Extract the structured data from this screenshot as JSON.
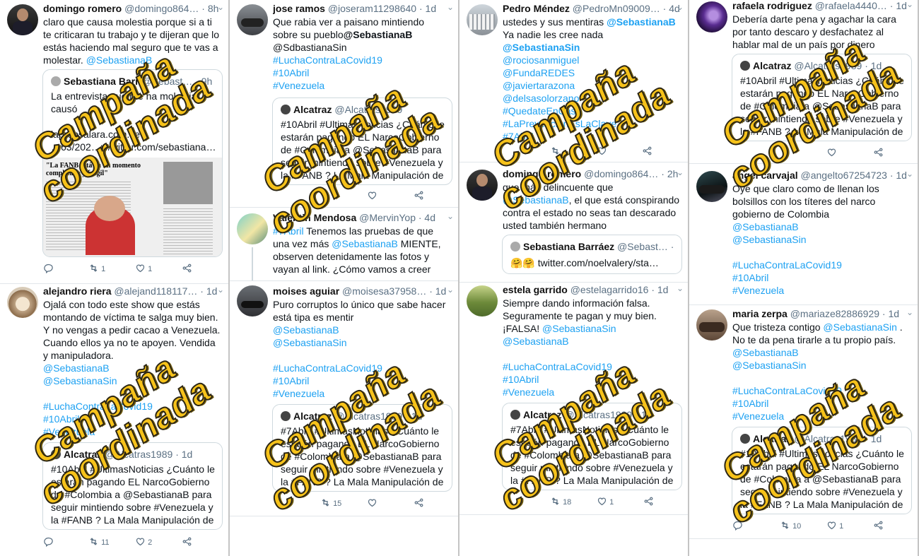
{
  "watermark": {
    "line1": "Campaña",
    "line2": "coordinada"
  },
  "col0": {
    "t1": {
      "name": "domingo romero",
      "handle": "@domingo864…",
      "time": "· 8h",
      "text_a": "claro que causa molestia porque si a ti te criticaran tu trabajo y te dijeran que lo estás haciendo mal seguro que te vas a molestar. ",
      "mention": "@SebastianaB",
      "q_name": "Sebastiana Barr",
      "q_handle": "@Sebast…",
      "q_time": "· 9h",
      "q_text": "La entrevista que me ha molestia causó",
      "q_link1": "laprensalara.com.ve",
      "q_link2": "…63/202…w/witter.com/sebastiana…",
      "img_head": "\"La FANB está en un momento complicado y frágil\"",
      "rt": "1",
      "like": "1"
    },
    "t2": {
      "name": "alejandro riera",
      "handle": "@alejand118117…",
      "time": "· 1d",
      "text": "Ojalá con todo este show que estás montando de víctima te salga muy bien. Y no vengas a pedir cacao a Venezuela. Cuando ellos ya no te apoyen. Vendida y manipuladora.",
      "m1": "@SebastianaB",
      "m2": "@SebastianaSin",
      "h1": "#LuchaContraLaCovid19",
      "h2": "#10Abril",
      "h3": "#Venezuela",
      "q_name": "Alcatraz",
      "q_handle": "@Alcatras1989",
      "q_time": "· 1d",
      "q_text": "#10Abril #UltimasNoticias ¿Cuánto le estarán pagando EL NarcoGobierno de #Colombia a  @SebastianaB para seguir mintiendo sobre #Venezuela y la #FANB ? La Mala Manipulación de …",
      "rt": "11",
      "like": "2"
    }
  },
  "col1": {
    "t1": {
      "name": "jose ramos",
      "handle": "@joseram11298640",
      "time": "· 1d",
      "text_a": "Que rabia ver a paisano mintiendo sobre su pueblo",
      "bold": "@SebastianaB",
      "line2": "@SdbastianaSin",
      "h1": "#LuchaContraLaCovid19",
      "h2": "#10Abril",
      "h3": "#Venezuela",
      "q_name": "Alcatraz",
      "q_handle": "@Alcatras1989",
      "q_text": "#10Abril #UltimasNoticias ¿Cuánto le estarán pagando EL NarcoGobierno de #Colombia a @SebastianaB para seguir mintiendo sobre #Venezuela y la #FANB ? La Mala Manipulación de …",
      "rt": "6"
    },
    "t2": {
      "name": "Valentin Mendosa",
      "handle": "@MervinYop",
      "time": "· 4d",
      "tag": "#7Abril",
      "text_a": " Tenemos las pruebas de que una vez más ",
      "mention": "@SebastianaB",
      "text_b": " MIENTE, observen detenidamente las fotos y vayan al link. ¿Cómo vamos a creer"
    },
    "t3": {
      "name": "moises aguiar",
      "handle": "@moisesa37958…",
      "time": "· 1d",
      "text": "Puro corruptos lo único que sabe hacer está tipa es mentir",
      "m1": "@SebastianaB",
      "m2": "@SebastianaSin",
      "h1": "#LuchaContraLaCovid19",
      "h2": "#10Abril",
      "h3": "#Venezuela",
      "q_name": "Alcatraz",
      "q_handle": "@Alcatras1989",
      "q_time": "· 1d",
      "q_text": "#7Abril #UltimasNoticias ¿Cuánto le estarán pagando EL NarcoGobierno de #Colombia a @SebastianaB para seguir mintiendo sobre #Venezuela y la #FANB ? La Mala Manipulación de …",
      "rt": "15"
    }
  },
  "col2": {
    "t1": {
      "name": "Pedro Méndez",
      "handle": "@PedroMn09009…",
      "time": "· 4d",
      "text_a": "ustedes y sus mentiras ",
      "mention": "@SebastianaB",
      "text_b": " Ya nadie les cree nada",
      "m_bold": "@SebastianaSin",
      "m2": "@rociosanmiguel",
      "m3": "@FundaREDES",
      "m4": "@javiertarazona",
      "m5": "@delsasolorzano",
      "h1": "#QuedateEnCasa",
      "h2": "#LaPrevencionEsLaClave",
      "h3": "#7Abril"
    },
    "t2": {
      "name": "domingo romero",
      "handle": "@domingo864…",
      "time": "· 2h",
      "text_a": "que más delincuente que ",
      "mention": "@SebastianaB",
      "text_b": ", el que está conspirando contra el estado no seas tan descarado usted también hermano",
      "q_name": "Sebastiana Barráez",
      "q_handle": "@Sebast…",
      "q_time": "· 5h",
      "q_text": "🤗🤗 twitter.com/noelvalery/sta…"
    },
    "t3": {
      "name": "estela garrido",
      "handle": "@estelagarrido16",
      "time": "· 1d",
      "text": "Siempre dando información falsa. Seguramente te pagan y muy bien. ¡FALSA! ",
      "m1": "@SebastianaSin",
      "m2": "@SebastianaB",
      "h1": "#LuchaContraLaCovid19",
      "h2": "#10Abril",
      "h3": "#Venezuela",
      "q_name": "Alcatraz",
      "q_handle": "@Alcatras1989",
      "q_time": "· 1d",
      "q_text": "#7Abril #UltimasNoticias ¿Cuánto le estarán pagando EL NarcoGobierno de #Colombia a @SebastianaB para seguir mintiendo sobre #Venezuela y la #FANB ? La Mala Manipulación de …",
      "rt": "18",
      "like": "1"
    }
  },
  "col3": {
    "t1": {
      "name": "rafaela rodriguez",
      "handle": "@rafaela4440…",
      "time": "· 1d",
      "text": "Debería darte pena y agachar la cara por tanto descaro y desfachatez al hablar mal de un país por dinero",
      "q_name": "Alcatraz",
      "q_handle": "@Alcatras1989",
      "q_time": "· 1d",
      "q_text": "#10Abril #UltimasNoticias ¿Cuánto le estarán pagando EL NarcoGobierno de #Colombia a @SebastianaB para seguir mintiendo sobre #Venezuela y la #FANB ? La Mala Manipulación de …"
    },
    "t2": {
      "name": "angel carvajal",
      "handle": "@angelto67254723",
      "time": "· 1d",
      "text": "Oye que claro como de llenan los bolsillos con los títeres del narco gobierno de Colombia",
      "m1": "@SebastianaB",
      "m2": "@SebastianaSin",
      "h1": "#LuchaContraLaCovid19",
      "h2": "#10Abril",
      "h3": "#Venezuela"
    },
    "t3": {
      "name": "maria zerpa",
      "handle": "@mariaze82886929",
      "time": "· 1d",
      "text_a": "Que tristeza contigo ",
      "mention": "@SebastianaSin",
      "text_b": " . No te da pena tirarle a tu propio país.",
      "m1": "@SebastianaB",
      "m2": "@SebastianaSin",
      "h1": "#LuchaContraLaCovid19",
      "h2": "#10Abril",
      "h3": "#Venezuela",
      "q_name": "Alcatraz",
      "q_handle": "@Alcatras1989",
      "q_time": "· 1d",
      "q_text": "#10Abril #UltimasNoticias ¿Cuánto le estarán pagando EL NarcoGobierno de #Colombia a  @SebastianaB para seguir mintiendo sobre #Venezuela y la #FANB ? La Mala Manipulación de …",
      "rt": "10",
      "like": "1"
    }
  }
}
